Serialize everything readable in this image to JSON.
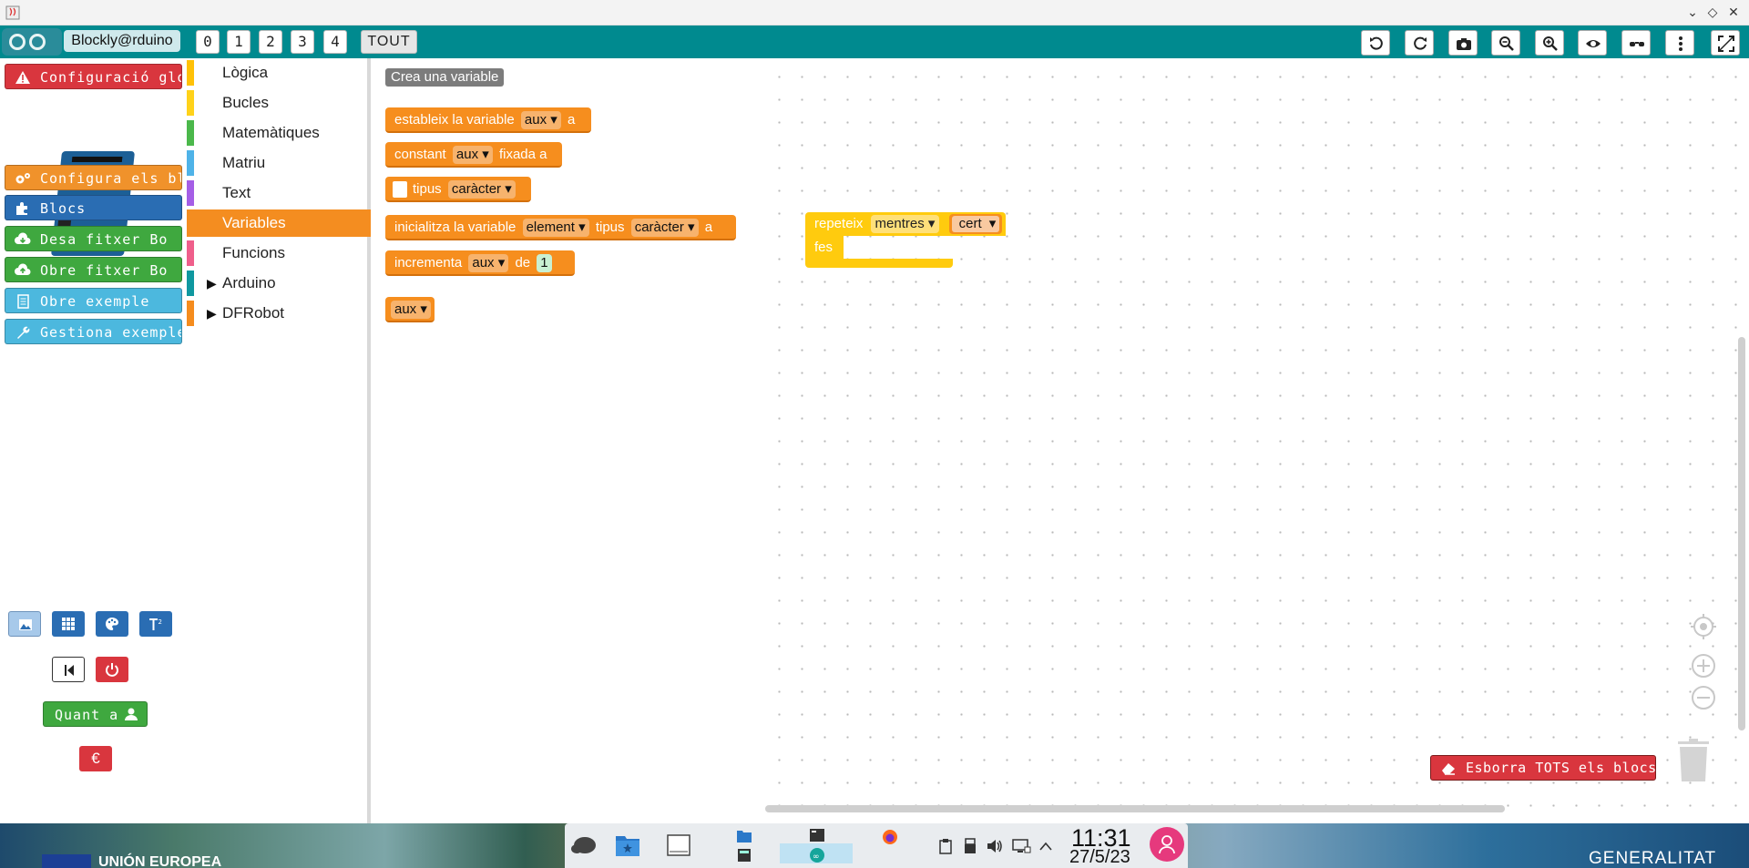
{
  "app": {
    "brand": "Blockly@rduino"
  },
  "levels": [
    "0",
    "1",
    "2",
    "3",
    "4"
  ],
  "level_all": "TOUT",
  "toolbar_icons": [
    "undo-icon",
    "redo-icon",
    "camera-icon",
    "zoom-out-icon",
    "zoom-in-icon",
    "eye-icon",
    "glasses-icon",
    "more-icon",
    "fullscreen-icon"
  ],
  "sidebar": {
    "config_global": "Configuració global",
    "config_blocks": "Configura els blocs",
    "blocks": "Blocs",
    "save_file": "Desa fitxer Bo",
    "open_file": "Obre fitxer Bo",
    "open_example": "Obre exemple",
    "manage_examples": "Gestiona exemples",
    "about": "Quant a",
    "euro": "€"
  },
  "categories": [
    {
      "label": "Lògica",
      "color": "#ffc107"
    },
    {
      "label": "Bucles",
      "color": "#ffd21a"
    },
    {
      "label": "Matemàtiques",
      "color": "#4bb84b"
    },
    {
      "label": "Matriu",
      "color": "#4fb3e8"
    },
    {
      "label": "Text",
      "color": "#a55ee6"
    },
    {
      "label": "Variables",
      "color": "#f48d20"
    },
    {
      "label": "Funcions",
      "color": "#ef5f8b"
    },
    {
      "label": "Arduino",
      "color": "#0f98a0"
    },
    {
      "label": "DFRobot",
      "color": "#f58c1d"
    }
  ],
  "selected_category": "Variables",
  "flyout": {
    "create_variable": "Crea una variable",
    "set_var": {
      "text": "estableix la variable",
      "var": "aux",
      "suffix": "a"
    },
    "constant": {
      "text": "constant",
      "var": "aux",
      "suffix": "fixada a"
    },
    "type": {
      "text": "tipus",
      "value": "caràcter"
    },
    "init": {
      "text": "inicialitza la variable",
      "var": "element",
      "type_label": "tipus",
      "type": "caràcter",
      "suffix": "a"
    },
    "increment": {
      "text": "incrementa",
      "var": "aux",
      "of": "de",
      "value": "1"
    },
    "getter": "aux"
  },
  "workspace": {
    "repeat": {
      "text": "repeteix",
      "mode": "mentres",
      "cond": "cert",
      "do": "fes"
    },
    "erase_all": "Esborra TOTS els blocs"
  },
  "desktop": {
    "eu": "UNIÓN EUROPEA",
    "generalitat": "GENERALITAT",
    "time": "11:31",
    "date": "27/5/23"
  }
}
